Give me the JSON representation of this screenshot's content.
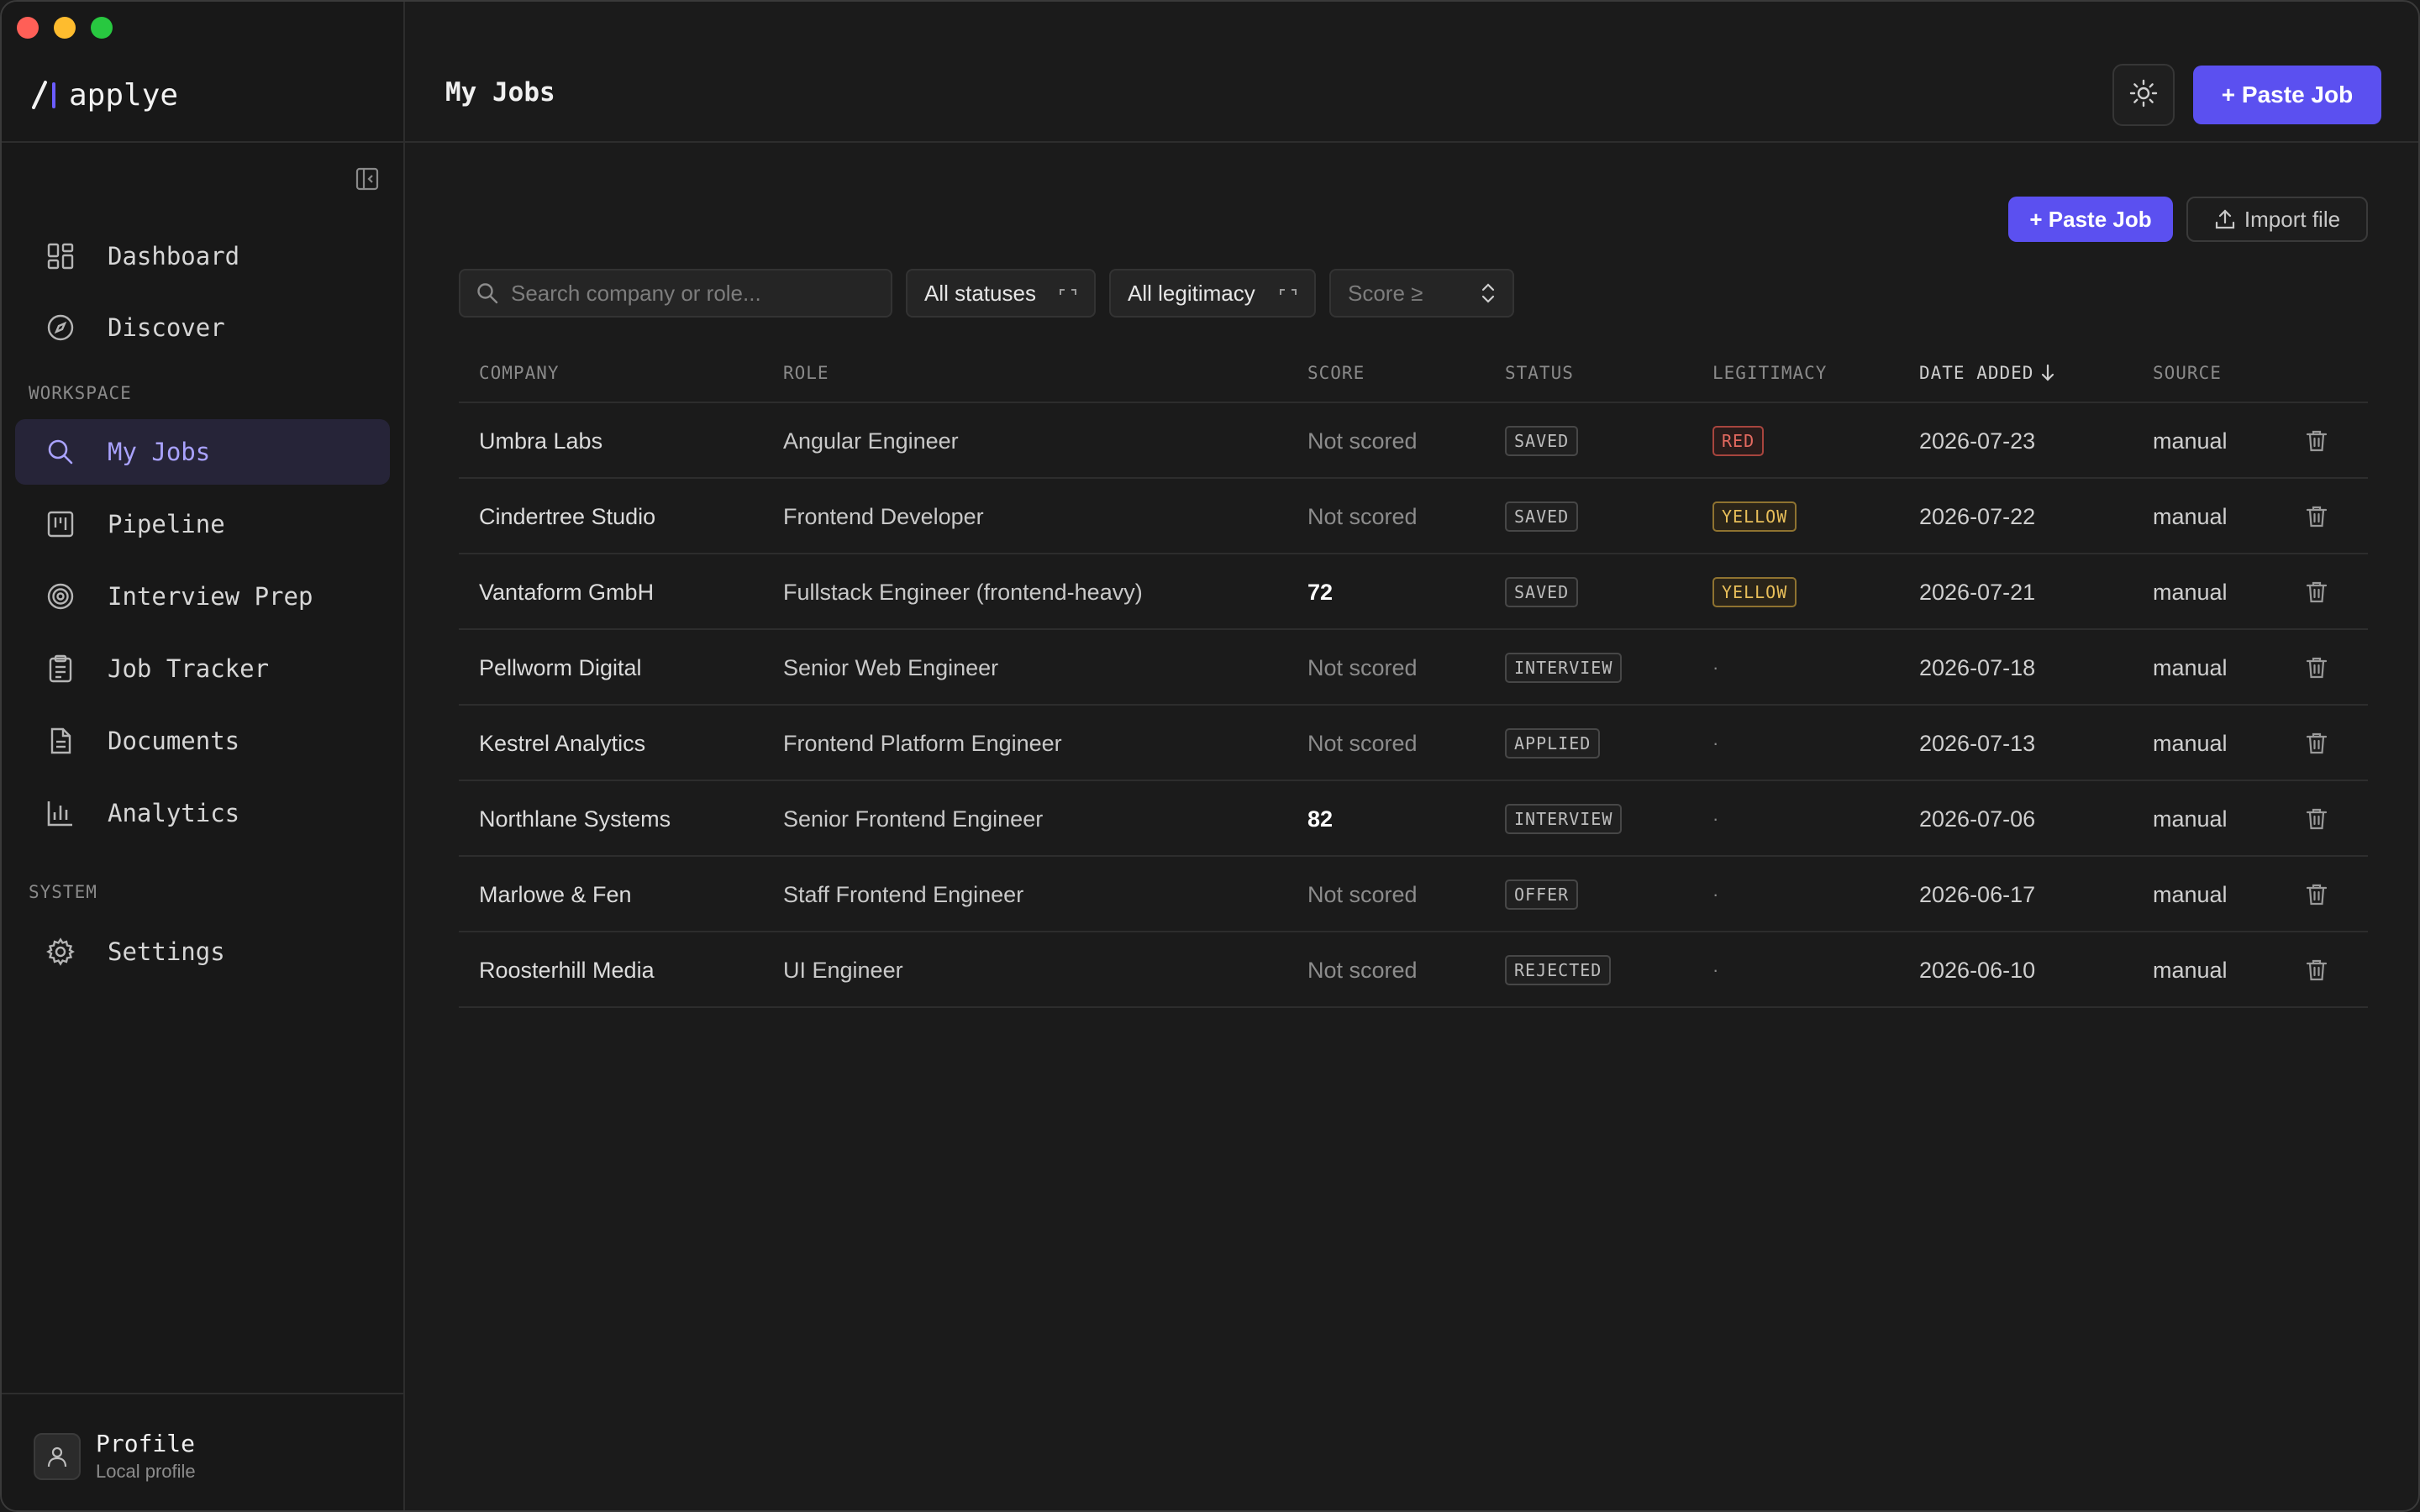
{
  "app": {
    "name": "applye"
  },
  "colors": {
    "accent": "#5b50f0",
    "active_nav_text": "#a9a2ff",
    "badge_red": "#e46a60",
    "badge_yellow": "#e9bf5a"
  },
  "sidebar": {
    "items_main": [
      {
        "label": "Dashboard",
        "icon": "dashboard-grid-icon"
      },
      {
        "label": "Discover",
        "icon": "compass-icon"
      }
    ],
    "section_workspace": "WORKSPACE",
    "items_workspace": [
      {
        "label": "My Jobs",
        "icon": "search-icon",
        "active": true
      },
      {
        "label": "Pipeline",
        "icon": "kanban-icon"
      },
      {
        "label": "Interview Prep",
        "icon": "target-icon"
      },
      {
        "label": "Job Tracker",
        "icon": "clipboard-icon"
      },
      {
        "label": "Documents",
        "icon": "document-icon"
      },
      {
        "label": "Analytics",
        "icon": "bar-chart-icon"
      }
    ],
    "section_system": "SYSTEM",
    "items_system": [
      {
        "label": "Settings",
        "icon": "gear-icon"
      }
    ],
    "profile": {
      "name": "Profile",
      "subtitle": "Local profile"
    }
  },
  "header": {
    "title": "My Jobs",
    "paste_job_label": "+ Paste Job"
  },
  "toolbar": {
    "paste_job_label": "+ Paste Job",
    "import_label": "Import file"
  },
  "filters": {
    "search_placeholder": "Search company or role...",
    "status_value": "All statuses",
    "legitimacy_value": "All legitimacy",
    "score_placeholder": "Score ≥"
  },
  "table": {
    "columns": {
      "company": "COMPANY",
      "role": "ROLE",
      "score": "SCORE",
      "status": "STATUS",
      "legitimacy": "LEGITIMACY",
      "date_added": "DATE ADDED",
      "source": "SOURCE"
    },
    "sort": {
      "column": "date_added",
      "direction": "desc"
    },
    "rows": [
      {
        "company": "Umbra Labs",
        "role": "Angular Engineer",
        "score": "Not scored",
        "status": "SAVED",
        "legitimacy": "RED",
        "date": "2026-07-23",
        "source": "manual"
      },
      {
        "company": "Cindertree Studio",
        "role": "Frontend Developer",
        "score": "Not scored",
        "status": "SAVED",
        "legitimacy": "YELLOW",
        "date": "2026-07-22",
        "source": "manual"
      },
      {
        "company": "Vantaform GmbH",
        "role": "Fullstack Engineer (frontend-heavy)",
        "score": "72",
        "status": "SAVED",
        "legitimacy": "YELLOW",
        "date": "2026-07-21",
        "source": "manual"
      },
      {
        "company": "Pellworm Digital",
        "role": "Senior Web Engineer",
        "score": "Not scored",
        "status": "INTERVIEW",
        "legitimacy": "·",
        "date": "2026-07-18",
        "source": "manual"
      },
      {
        "company": "Kestrel Analytics",
        "role": "Frontend Platform Engineer",
        "score": "Not scored",
        "status": "APPLIED",
        "legitimacy": "·",
        "date": "2026-07-13",
        "source": "manual"
      },
      {
        "company": "Northlane Systems",
        "role": "Senior Frontend Engineer",
        "score": "82",
        "status": "INTERVIEW",
        "legitimacy": "·",
        "date": "2026-07-06",
        "source": "manual"
      },
      {
        "company": "Marlowe & Fen",
        "role": "Staff Frontend Engineer",
        "score": "Not scored",
        "status": "OFFER",
        "legitimacy": "·",
        "date": "2026-06-17",
        "source": "manual"
      },
      {
        "company": "Roosterhill Media",
        "role": "UI Engineer",
        "score": "Not scored",
        "status": "REJECTED",
        "legitimacy": "·",
        "date": "2026-06-10",
        "source": "manual"
      }
    ]
  }
}
